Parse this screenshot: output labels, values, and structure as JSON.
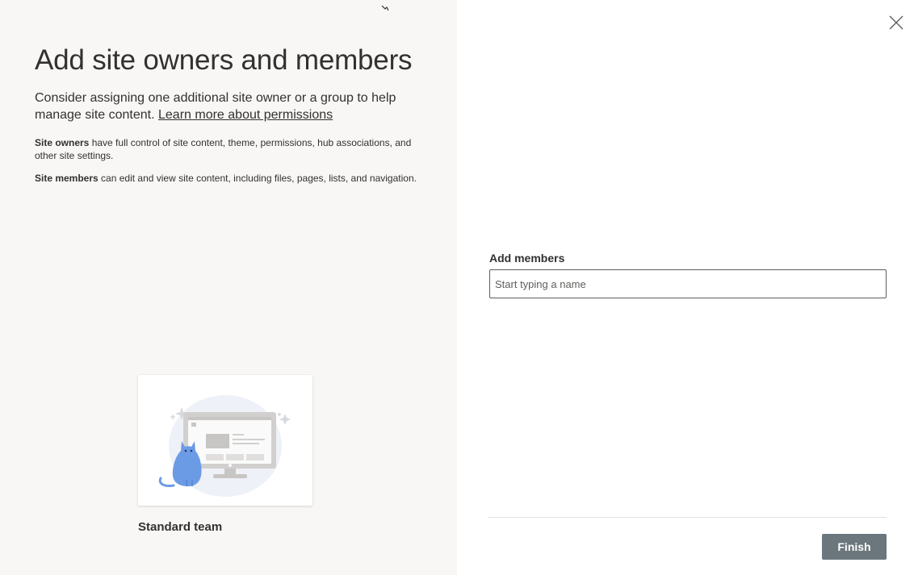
{
  "left": {
    "title": "Add site owners and members",
    "intro": "Consider assigning one additional site owner or a group to help manage site content.",
    "learn_more_link": "Learn more about permissions",
    "owners_term": "Site owners",
    "owners_text": "have full control of site content, theme, permissions, hub associations, and other site settings.",
    "members_term": "Site members",
    "members_text": "can edit and view site content, including files, pages, lists, and navigation.",
    "template_name": "Standard team"
  },
  "right": {
    "close_icon": "close-icon",
    "field_label": "Add members",
    "field_placeholder": "Start typing a name",
    "field_value": "",
    "finish_label": "Finish"
  },
  "colors": {
    "left_panel_bg": "#f8f7f5",
    "finish_button_bg": "#6b767d",
    "illustration_accent": "#6c9be6"
  }
}
